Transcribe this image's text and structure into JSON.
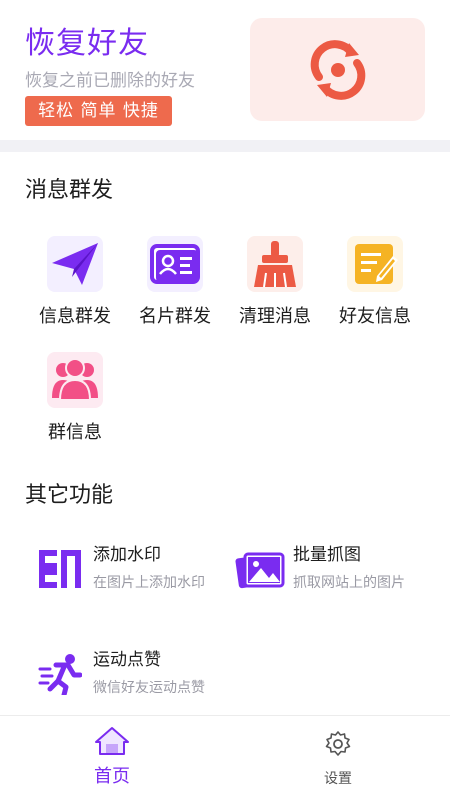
{
  "banner": {
    "title": "恢复好友",
    "subtitle": "恢复之前已删除的好友",
    "tag": "轻松 简单 快捷",
    "icon": "restore-icon"
  },
  "section_messages": {
    "title": "消息群发",
    "items": [
      {
        "label": "信息群发",
        "icon": "paper-plane-icon"
      },
      {
        "label": "名片群发",
        "icon": "contact-card-icon"
      },
      {
        "label": "清理消息",
        "icon": "broom-icon"
      },
      {
        "label": "好友信息",
        "icon": "note-edit-icon"
      },
      {
        "label": "群信息",
        "icon": "group-icon"
      }
    ]
  },
  "section_other": {
    "title": "其它功能",
    "items": [
      {
        "title": "添加水印",
        "desc": "在图片上添加水印",
        "icon": "stamp-icon"
      },
      {
        "title": "批量抓图",
        "desc": "抓取网站上的图片",
        "icon": "images-icon"
      },
      {
        "title": "运动点赞",
        "desc": "微信好友运动点赞",
        "icon": "running-icon"
      }
    ]
  },
  "tabbar": {
    "tabs": [
      {
        "label": "首页",
        "icon": "home-icon",
        "active": true
      },
      {
        "label": "设置",
        "icon": "gear-icon",
        "active": false
      }
    ]
  },
  "colors": {
    "accent": "#7a2cf0",
    "tag_bg": "#ee6a4d",
    "banner_card_bg": "#fdecea",
    "icon_orange": "#f5b324",
    "icon_red": "#ec5a44",
    "icon_pink": "#f24f86"
  }
}
